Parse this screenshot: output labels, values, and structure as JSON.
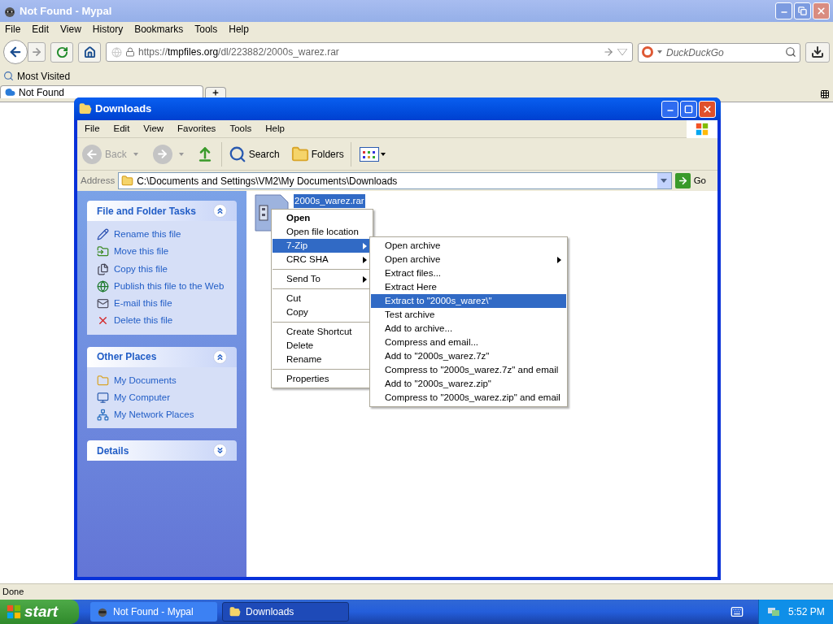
{
  "browser": {
    "title": "Not Found - Mypal",
    "menu": [
      "File",
      "Edit",
      "View",
      "History",
      "Bookmarks",
      "Tools",
      "Help"
    ],
    "url": {
      "scheme": "https://",
      "host": "tmpfiles.org",
      "path": "/dl/223882/2000s_warez.rar"
    },
    "search": {
      "placeholder": "DuckDuckGo"
    },
    "bookmarks": [
      "Most Visited"
    ],
    "tabs": [
      {
        "label": "Not Found",
        "selected": true
      }
    ],
    "status": "Done"
  },
  "explorer": {
    "title": "Downloads",
    "menu": [
      "File",
      "Edit",
      "View",
      "Favorites",
      "Tools",
      "Help"
    ],
    "toolbar": {
      "back": "Back",
      "search": "Search",
      "folders": "Folders"
    },
    "address_label": "Address",
    "address": "C:\\Documents and Settings\\VM2\\My Documents\\Downloads",
    "go": "Go",
    "panels": [
      {
        "title": "File and Folder Tasks",
        "expanded": true,
        "items": [
          {
            "label": "Rename this file",
            "kind": "rename"
          },
          {
            "label": "Move this file",
            "kind": "move"
          },
          {
            "label": "Copy this file",
            "kind": "copy"
          },
          {
            "label": "Publish this file to the Web",
            "kind": "web"
          },
          {
            "label": "E-mail this file",
            "kind": "mail"
          },
          {
            "label": "Delete this file",
            "kind": "delete"
          }
        ]
      },
      {
        "title": "Other Places",
        "expanded": true,
        "items": [
          {
            "label": "My Documents",
            "kind": "folder"
          },
          {
            "label": "My Computer",
            "kind": "computer"
          },
          {
            "label": "My Network Places",
            "kind": "network"
          }
        ]
      },
      {
        "title": "Details",
        "expanded": false
      }
    ],
    "file": {
      "name": "2000s_warez.rar",
      "selected": true
    }
  },
  "context_menu": [
    [
      {
        "label": "Open",
        "default": true,
        "submenu": false,
        "selected": false
      },
      {
        "label": "Open file location",
        "default": false,
        "submenu": false,
        "selected": false
      },
      {
        "label": "7-Zip",
        "default": false,
        "submenu": true,
        "selected": true
      },
      {
        "label": "CRC SHA",
        "default": false,
        "submenu": true,
        "selected": false
      }
    ],
    [
      {
        "label": "Send To",
        "default": false,
        "submenu": true,
        "selected": false
      }
    ],
    [
      {
        "label": "Cut",
        "default": false,
        "submenu": false,
        "selected": false
      },
      {
        "label": "Copy",
        "default": false,
        "submenu": false,
        "selected": false
      }
    ],
    [
      {
        "label": "Create Shortcut",
        "default": false,
        "submenu": false,
        "selected": false
      },
      {
        "label": "Delete",
        "default": false,
        "submenu": false,
        "selected": false
      },
      {
        "label": "Rename",
        "default": false,
        "submenu": false,
        "selected": false
      }
    ],
    [
      {
        "label": "Properties",
        "default": false,
        "submenu": false,
        "selected": false
      }
    ]
  ],
  "submenu": [
    {
      "label": "Open archive",
      "submenu": false,
      "selected": false
    },
    {
      "label": "Open archive",
      "submenu": true,
      "selected": false
    },
    {
      "label": "Extract files...",
      "submenu": false,
      "selected": false
    },
    {
      "label": "Extract Here",
      "submenu": false,
      "selected": false
    },
    {
      "label": "Extract to \"2000s_warez\\\"",
      "submenu": false,
      "selected": true
    },
    {
      "label": "Test archive",
      "submenu": false,
      "selected": false
    },
    {
      "label": "Add to archive...",
      "submenu": false,
      "selected": false
    },
    {
      "label": "Compress and email...",
      "submenu": false,
      "selected": false
    },
    {
      "label": "Add to \"2000s_warez.7z\"",
      "submenu": false,
      "selected": false
    },
    {
      "label": "Compress to \"2000s_warez.7z\" and email",
      "submenu": false,
      "selected": false
    },
    {
      "label": "Add to \"2000s_warez.zip\"",
      "submenu": false,
      "selected": false
    },
    {
      "label": "Compress to \"2000s_warez.zip\" and email",
      "submenu": false,
      "selected": false
    }
  ],
  "taskbar": {
    "start": "start",
    "tasks": [
      {
        "label": "Not Found - Mypal",
        "kind": "browser",
        "selected": false
      },
      {
        "label": "Downloads",
        "kind": "folder",
        "selected": true
      }
    ],
    "clock": "5:52 PM"
  }
}
